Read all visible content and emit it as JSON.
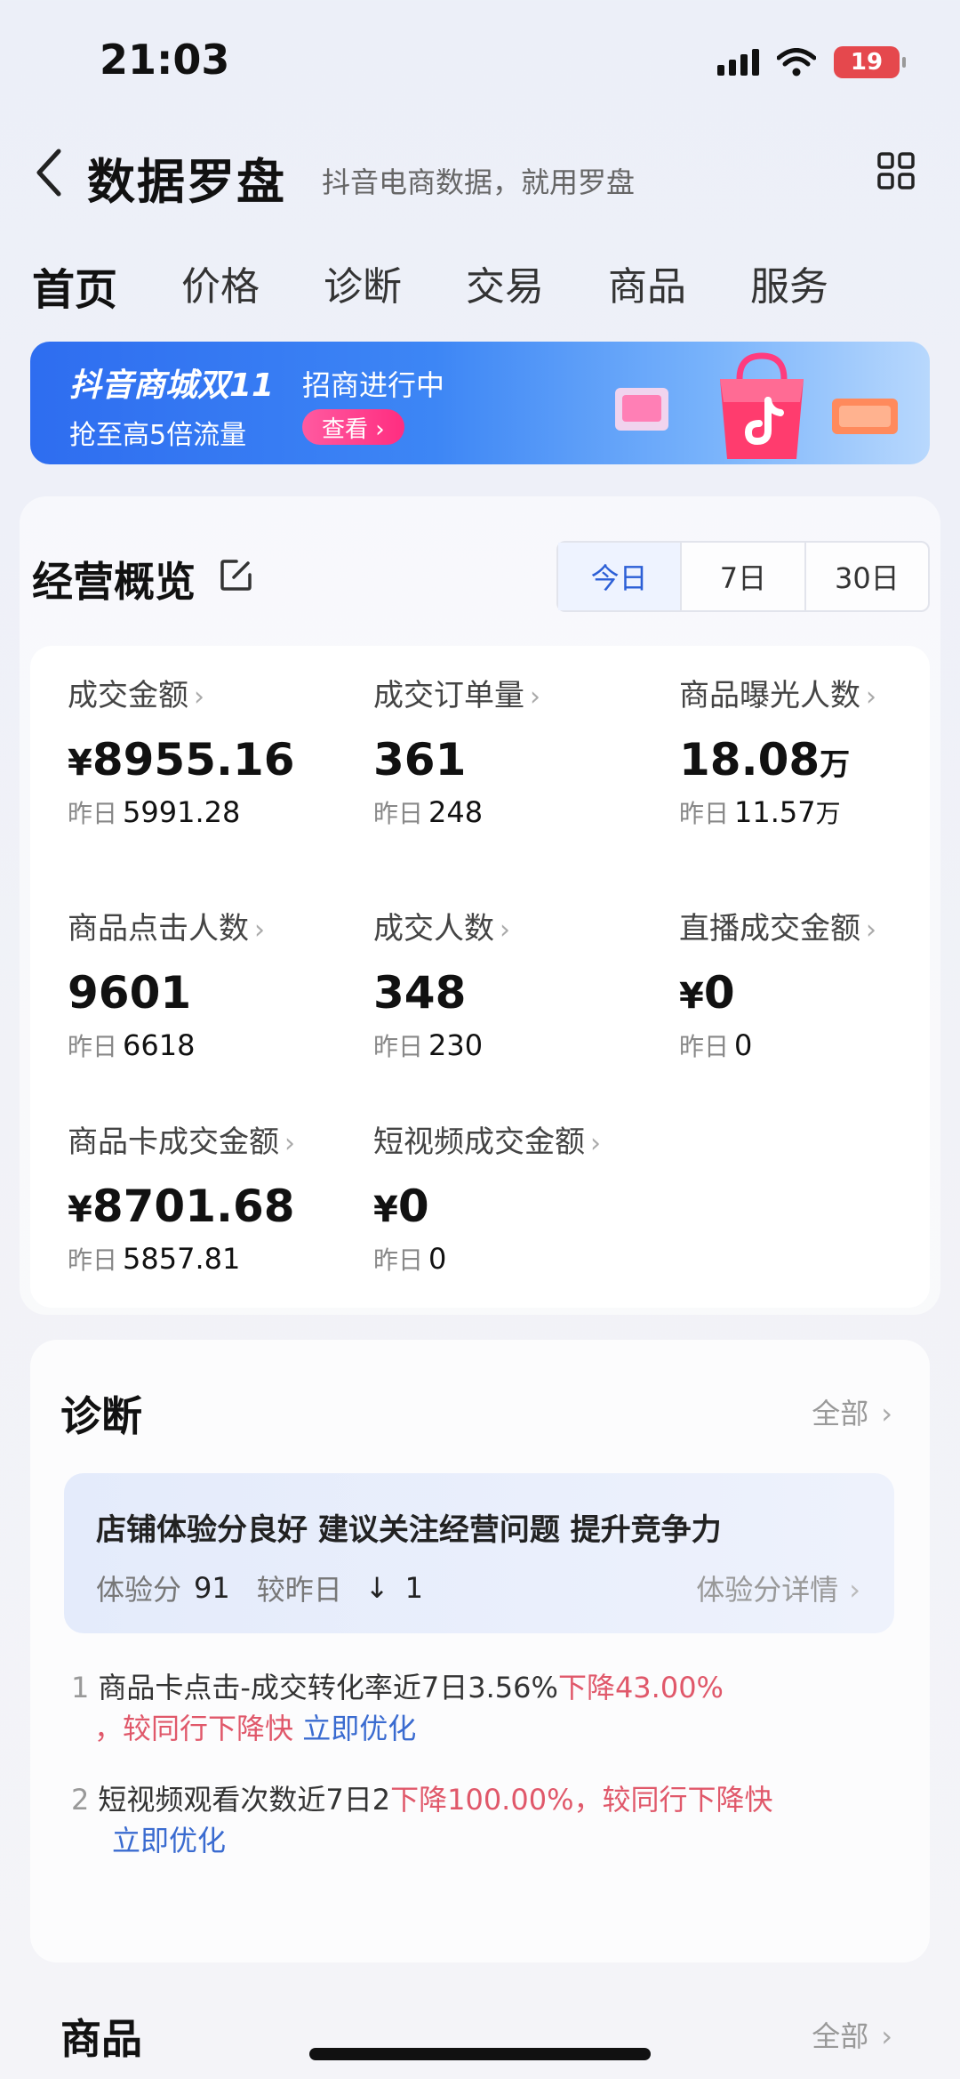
{
  "status": {
    "time": "21:03",
    "battery": "19"
  },
  "header": {
    "title": "数据罗盘",
    "subtitle": "抖音电商数据，就用罗盘"
  },
  "tabs": [
    {
      "label": "首页",
      "active": true
    },
    {
      "label": "价格"
    },
    {
      "label": "诊断"
    },
    {
      "label": "交易"
    },
    {
      "label": "商品"
    },
    {
      "label": "服务"
    }
  ],
  "banner": {
    "title": "抖音商城双11",
    "tag": "招商进行中",
    "subtitle": "抢至高5倍流量",
    "button": "查看 ›"
  },
  "overview": {
    "title": "经营概览",
    "periods": [
      "今日",
      "7日",
      "30日"
    ],
    "prev_label": "昨日",
    "metrics": [
      {
        "label": "成交金额",
        "prefix": "¥",
        "value": "8955.16",
        "unit": "",
        "prev": "5991.28",
        "prev_unit": ""
      },
      {
        "label": "成交订单量",
        "prefix": "",
        "value": "361",
        "unit": "",
        "prev": "248",
        "prev_unit": ""
      },
      {
        "label": "商品曝光人数",
        "prefix": "",
        "value": "18.08",
        "unit": "万",
        "prev": "11.57",
        "prev_unit": "万"
      },
      {
        "label": "商品点击人数",
        "prefix": "",
        "value": "9601",
        "unit": "",
        "prev": "6618",
        "prev_unit": ""
      },
      {
        "label": "成交人数",
        "prefix": "",
        "value": "348",
        "unit": "",
        "prev": "230",
        "prev_unit": ""
      },
      {
        "label": "直播成交金额",
        "prefix": "¥",
        "value": "0",
        "unit": "",
        "prev": "0",
        "prev_unit": ""
      },
      {
        "label": "商品卡成交金额",
        "prefix": "¥",
        "value": "8701.68",
        "unit": "",
        "prev": "5857.81",
        "prev_unit": ""
      },
      {
        "label": "短视频成交金额",
        "prefix": "¥",
        "value": "0",
        "unit": "",
        "prev": "0",
        "prev_unit": ""
      }
    ]
  },
  "diagnosis": {
    "title": "诊断",
    "all": "全部",
    "headline": "店铺体验分良好 建议关注经营问题 提升竞争力",
    "score_label": "体验分",
    "score": "91",
    "compare_label": "较昨日",
    "arrow": "↓",
    "change": "1",
    "detail": "体验分详情",
    "issues": [
      {
        "index": "1",
        "text": "商品卡点击-成交转化率近7日3.56%",
        "red": "下降43.00%",
        "red2": "，较同行下降快",
        "link": "立即优化"
      },
      {
        "index": "2",
        "text": "短视频观看次数近7日2",
        "red": "下降100.00%，较同行下降快",
        "red2": "",
        "link": "立即优化"
      }
    ]
  },
  "products": {
    "title": "商品",
    "all": "全部"
  }
}
